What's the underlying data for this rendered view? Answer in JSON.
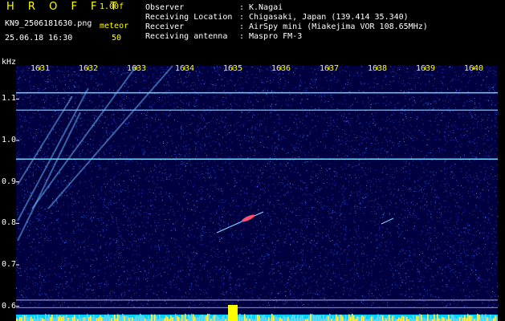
{
  "header": {
    "app_name": "H R O F F T",
    "version": "1.00f",
    "file_name": "KN9_2506181630.png",
    "datetime": "25.06.18 16:30",
    "meteor_label": "meteor",
    "meteor_count": "50",
    "fields": [
      {
        "label": "Observer",
        "value": "K.Nagai"
      },
      {
        "label": "Receiving Location",
        "value": "Chigasaki, Japan (139.414 35.340)"
      },
      {
        "label": "Receiver",
        "value": "AirSpy mini (Miakejima VOR 108.65MHz)"
      },
      {
        "label": "Receiving antenna",
        "value": "Maspro FM-3"
      }
    ]
  },
  "chart_data": {
    "type": "heatmap",
    "ylabel": "kHz",
    "x_ticks": [
      "1631",
      "1632",
      "1633",
      "1634",
      "1635",
      "1636",
      "1637",
      "1638",
      "1639",
      "1640"
    ],
    "y_ticks": [
      "1.1",
      "1.0",
      "0.9",
      "0.8",
      "0.7",
      "0.6"
    ],
    "xlim": [
      1630.5,
      1640.5
    ],
    "ylim": [
      0.58,
      1.18
    ],
    "horizontal_lines_khz": [
      1.115,
      1.073,
      0.955,
      0.615,
      0.597
    ],
    "colors": {
      "background": "#000040",
      "noise": "#1f3fbf",
      "line": "#70d0ff",
      "meteor": "#ff5070",
      "bottom_bar": "#00d0ff",
      "bottom_peak": "#ffff00"
    }
  }
}
